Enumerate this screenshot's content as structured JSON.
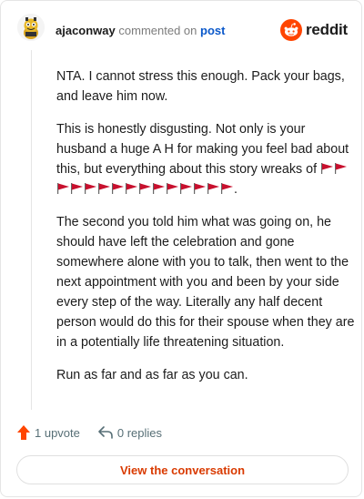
{
  "header": {
    "username": "ajaconway",
    "commented_text": "commented on",
    "post_link": "post",
    "brand": "reddit",
    "icons": {
      "avatar": "snoo-avatar",
      "brand": "reddit-logo-icon"
    }
  },
  "comment": {
    "paragraphs": [
      "NTA. I cannot stress this enough. Pack your bags, and leave him now.",
      "This is honestly disgusting. Not only is your husband a huge A H for making you feel bad about this, but everything about this story wreaks of",
      "The second you told him what was going on, he should have left the celebration and gone somewhere alone with you to talk, then went to the next appointment with you and been by your side every step of the way. Literally any half decent person would do this for their spouse when they are in a potentially life threatening situation.",
      "Run as far and as far as you can."
    ],
    "red_flag_count": 15,
    "trailing_period": "."
  },
  "actions": {
    "upvote_label": "1 upvote",
    "replies_label": "0 replies",
    "icons": {
      "upvote": "upvote-arrow-icon",
      "reply": "reply-arrow-icon"
    }
  },
  "cta": {
    "view_label": "View the conversation"
  },
  "colors": {
    "accent": "#ff4500",
    "cta_text": "#d93a00",
    "link": "#0a58ca",
    "flag": "#c8102e"
  }
}
